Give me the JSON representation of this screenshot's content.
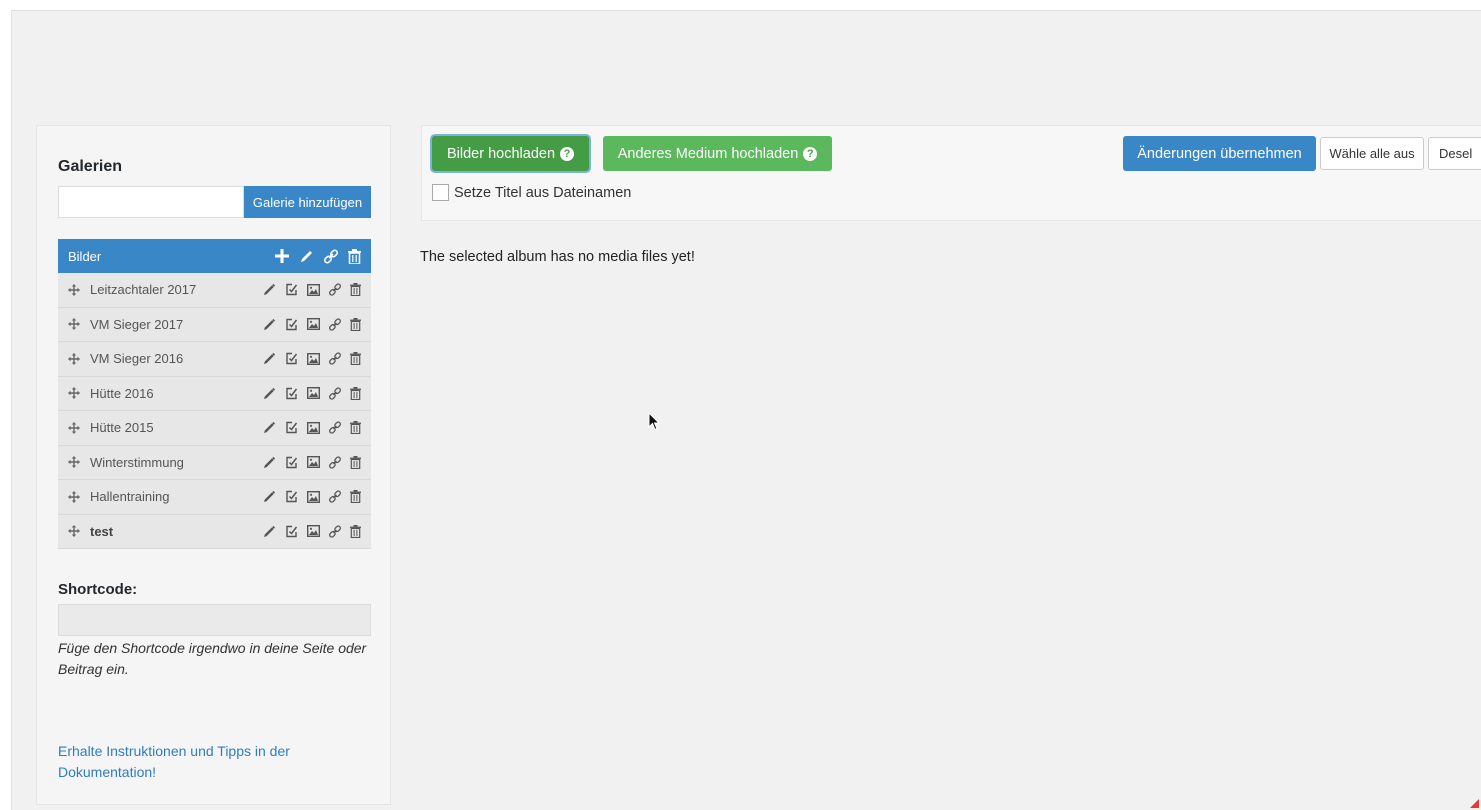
{
  "sidebar": {
    "title": "Galerien",
    "new_gallery_placeholder": "",
    "add_gallery_label": "Galerie hinzufügen",
    "list_header": "Bilder",
    "galleries": [
      {
        "name": "Leitzachtaler 2017",
        "bold": false
      },
      {
        "name": "VM Sieger 2017",
        "bold": false
      },
      {
        "name": "VM Sieger 2016",
        "bold": false
      },
      {
        "name": "Hütte 2016",
        "bold": false
      },
      {
        "name": "Hütte 2015",
        "bold": false
      },
      {
        "name": "Winterstimmung",
        "bold": false
      },
      {
        "name": "Hallentraining",
        "bold": false
      },
      {
        "name": "test",
        "bold": true
      }
    ],
    "shortcode_label": "Shortcode:",
    "shortcode_value": "",
    "shortcode_hint": "Füge den Shortcode irgendwo in deine Seite oder Beitrag ein.",
    "docs_link": "Erhalte Instruktionen und Tipps in der Dokumentation!"
  },
  "toolbar": {
    "upload_images_label": "Bilder hochladen",
    "upload_other_label": "Anderes Medium hochladen",
    "apply_changes_label": "Änderungen übernehmen",
    "select_all_label": "Wähle alle aus",
    "deselect_label": "Desel",
    "help_glyph": "?",
    "title_from_filename_label": "Setze Titel aus Dateinamen",
    "title_from_filename_checked": false
  },
  "main": {
    "empty_message": "The selected album has no media files yet!"
  },
  "colors": {
    "primary": "#3a87c8",
    "success": "#5cb85c",
    "success_active": "#449d44",
    "link": "#2f7dc1"
  },
  "icons": {
    "header": [
      "plus-icon",
      "pencil-icon",
      "link-icon",
      "trash-icon"
    ],
    "row": [
      "pencil-icon",
      "edit-check-icon",
      "image-icon",
      "link-icon",
      "trash-icon"
    ],
    "drag": "move-icon"
  }
}
